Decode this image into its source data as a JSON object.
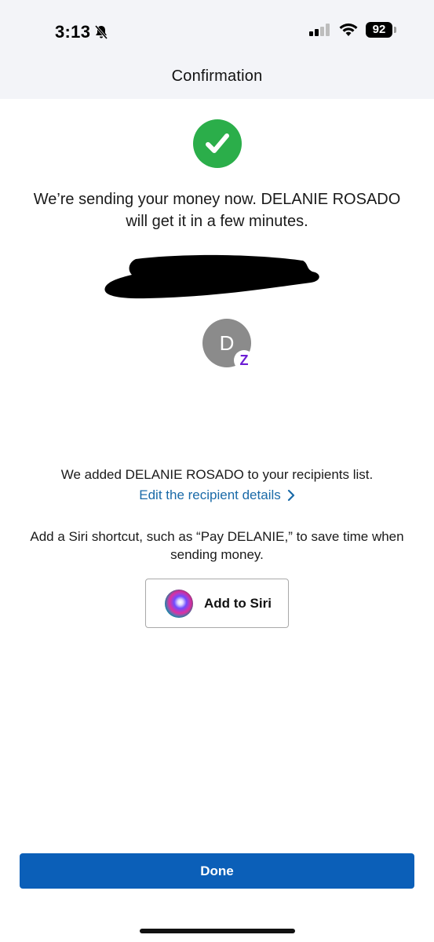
{
  "status_bar": {
    "time": "3:13",
    "battery": "92",
    "icons": [
      "bell-slash-icon",
      "cellular-signal-icon",
      "wifi-icon",
      "battery-icon"
    ]
  },
  "nav": {
    "title": "Confirmation"
  },
  "confirmation": {
    "icon": "check-circle-icon",
    "message": "We’re sending your money now. DELANIE ROSADO will get it in a few minutes."
  },
  "recipient": {
    "initial": "D",
    "badge_icon": "zelle-icon",
    "badge_glyph": "Z"
  },
  "recipients_notice": {
    "text": "We added DELANIE ROSADO to your recipients list.",
    "edit_link": "Edit the recipient details"
  },
  "siri": {
    "text": "Add a Siri shortcut, such as “Pay DELANIE,” to save time when sending money.",
    "button_label": "Add to Siri",
    "icon": "siri-icon"
  },
  "footer": {
    "done_label": "Done"
  },
  "colors": {
    "success": "#2bae4a",
    "primary": "#0b5fb8",
    "link": "#1a6aa8",
    "zelle": "#6d1ed4"
  }
}
